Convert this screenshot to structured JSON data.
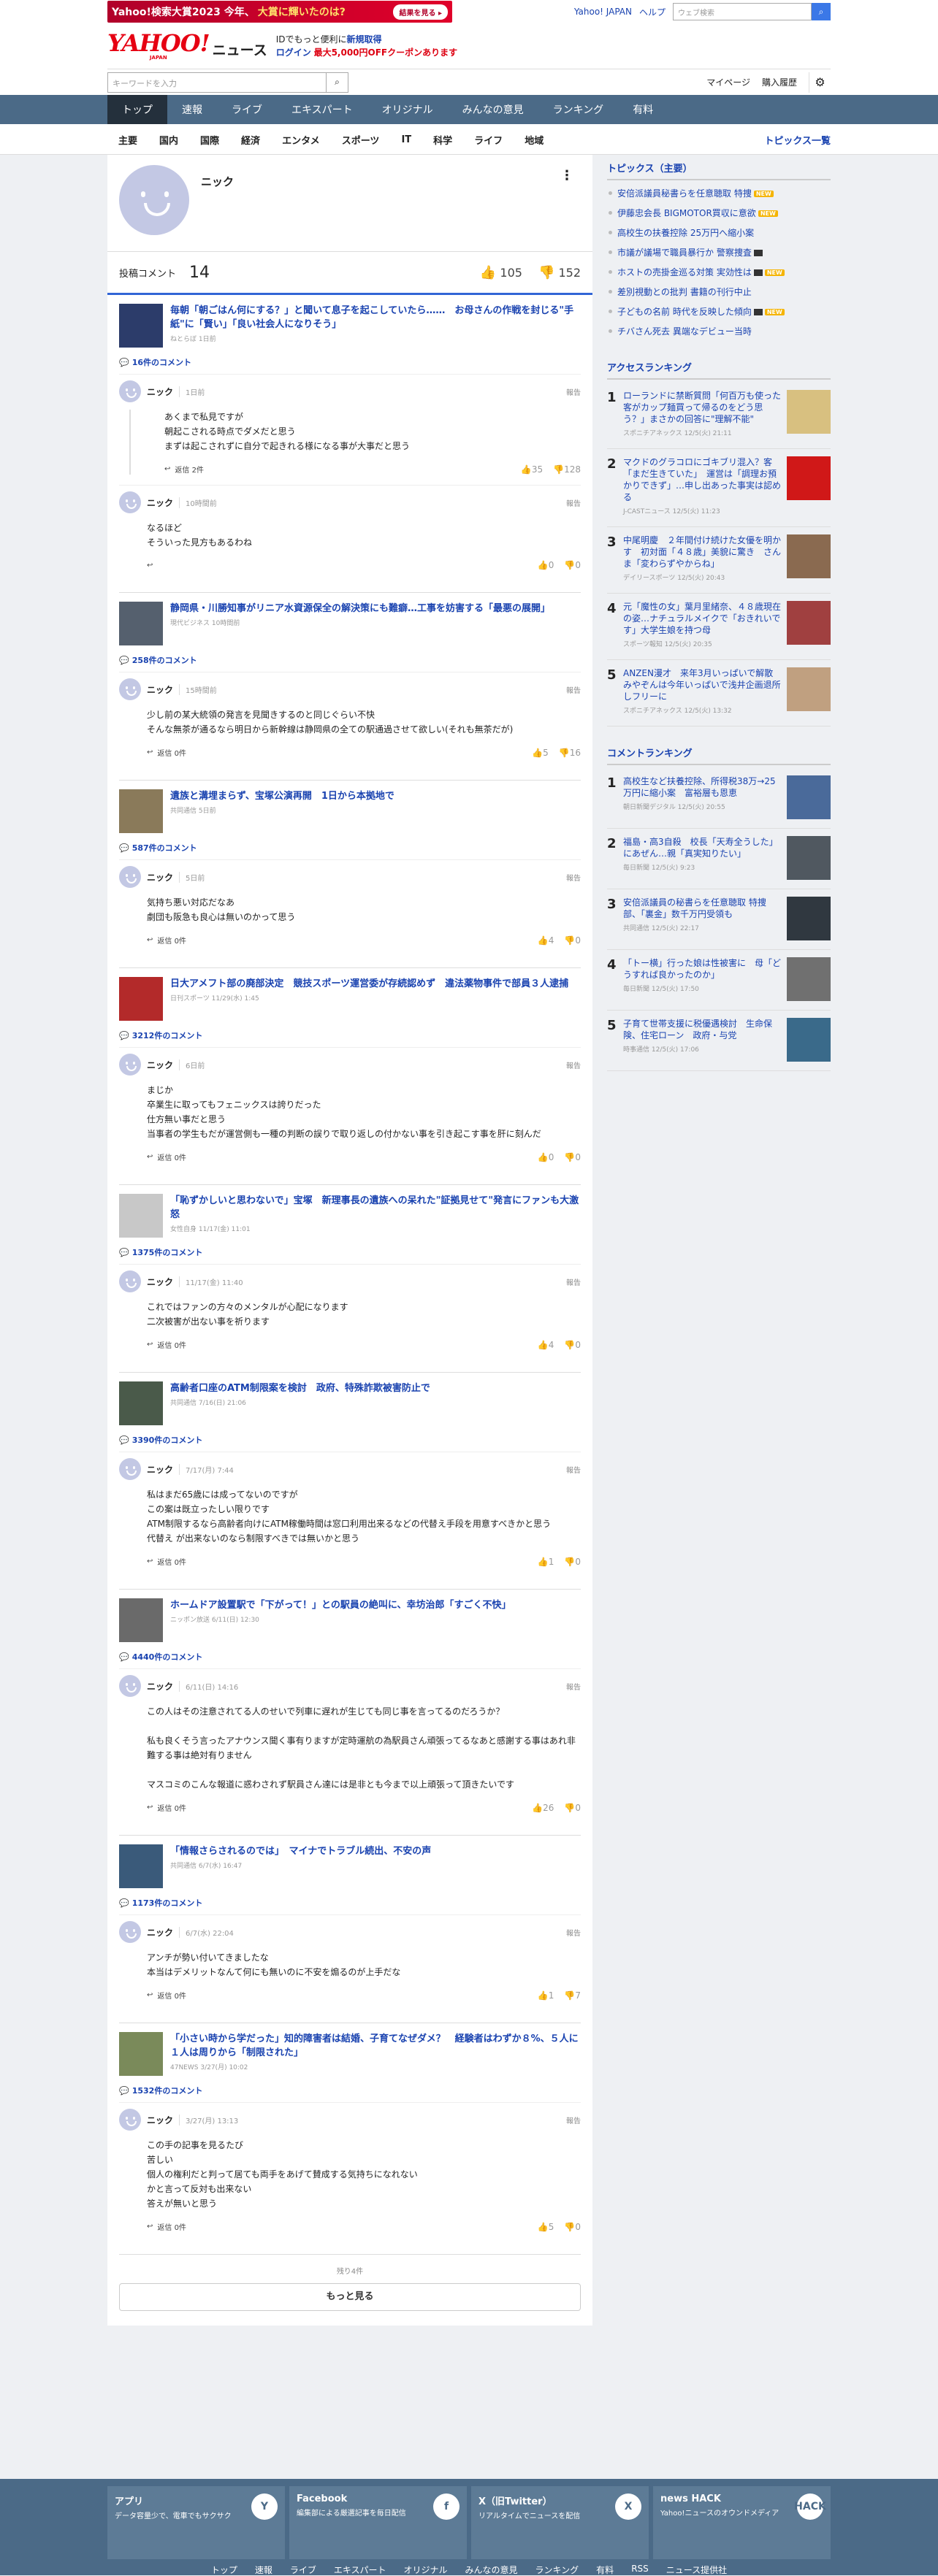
{
  "header": {
    "promo": {
      "text": "Yahoo!検索大賞2023 今年、",
      "highlight": "大賞に輝いたのは?",
      "button": "結果を見る ▸"
    },
    "top_links": [
      "Yahoo! JAPAN",
      "ヘルプ"
    ],
    "web_search_placeholder": "ウェブ検索",
    "logo_main": "YAHOO!",
    "logo_sub": "JAPAN",
    "logo_section": "ニュース",
    "login_line1": "IDでもっと便利に",
    "login_line1_b": "新規取得",
    "login_line2": "ログイン",
    "login_coupon": "最大5,000円OFFクーポンあります",
    "search_placeholder": "キーワードを入力",
    "links": [
      "マイページ",
      "購入履歴"
    ]
  },
  "main_nav": [
    "トップ",
    "速報",
    "ライブ",
    "エキスパート",
    "オリジナル",
    "みんなの意見",
    "ランキング",
    "有料"
  ],
  "sub_nav": [
    "主要",
    "国内",
    "国際",
    "経済",
    "エンタメ",
    "スポーツ",
    "IT",
    "科学",
    "ライフ",
    "地域"
  ],
  "sub_nav_more": "トピックス一覧",
  "profile": {
    "name": "ニック",
    "kebab": "⋮",
    "label": "投稿コメント",
    "count": "14",
    "likes": "105",
    "dislikes": "152"
  },
  "articles": [
    {
      "title": "毎朝「朝ごはん何にする？」と聞いて息子を起こしていたら……　お母さんの作戦を封じる\"手紙\"に「賢い」「良い社会人になりそう」",
      "src": "ねとらぼ 1日前",
      "ccount": "16件のコメント",
      "img": "#2c3c6a",
      "comments": [
        {
          "date": "1日前",
          "body": "あくまで私見ですが\n朝起こされる時点でダメだと思う\nまずは起こされずに自分で起きれる様になる事が大事だと思う",
          "reply": "返信 2件",
          "up": "35",
          "down": "128",
          "thread": true
        },
        {
          "date": "10時間前",
          "body": "なるほど\nそういった見方もあるわね",
          "reply": "",
          "up": "0",
          "down": "0",
          "thread": false
        }
      ]
    },
    {
      "title": "静岡県・川勝知事がリニア水資源保全の解決策にも難癖…工事を妨害する「最悪の展開」",
      "src": "現代ビジネス 10時間前",
      "ccount": "258件のコメント",
      "img": "#55606e",
      "comments": [
        {
          "date": "15時間前",
          "body": "少し前の某大統領の発言を見聞きするのと同じぐらい不快\nそんな無茶が通るなら明日から新幹線は静岡県の全ての駅通過させて欲しい(それも無茶だが)",
          "reply": "返信 0件",
          "up": "5",
          "down": "16",
          "thread": false
        }
      ]
    },
    {
      "title": "遺族と溝埋まらず、宝塚公演再開　1日から本拠地で",
      "src": "共同通信 5日前",
      "ccount": "587件のコメント",
      "img": "#8a7a5a",
      "comments": [
        {
          "date": "5日前",
          "body": "気持ち悪い対応だなあ\n劇団も阪急も良心は無いのかって思う",
          "reply": "返信 0件",
          "up": "4",
          "down": "0",
          "thread": false
        }
      ]
    },
    {
      "title": "日大アメフト部の廃部決定　競技スポーツ運営委が存続認めず　違法薬物事件で部員３人逮捕",
      "src": "日刊スポーツ 11/29(水) 1:45",
      "ccount": "3212件のコメント",
      "img": "#b32a2a",
      "comments": [
        {
          "date": "6日前",
          "body": "まじか\n卒業生に取ってもフェニックスは誇りだった\n仕方無い事だと思う\n当事者の学生もだが運営側も一種の判断の誤りで取り返しの付かない事を引き起こす事を肝に刻んだ",
          "reply": "返信 0件",
          "up": "0",
          "down": "0",
          "thread": false
        }
      ]
    },
    {
      "title": "「恥ずかしいと思わないで」宝塚　新理事長の遺族への呆れた\"証拠見せて\"発言にファンも大激怒",
      "src": "女性自身 11/17(金) 11:01",
      "ccount": "1375件のコメント",
      "img": "#c8c8c8",
      "comments": [
        {
          "date": "11/17(金) 11:40",
          "body": "これではファンの方々のメンタルが心配になります\n二次被害が出ない事を祈ります",
          "reply": "返信 0件",
          "up": "4",
          "down": "0",
          "thread": false
        }
      ]
    },
    {
      "title": "高齢者口座のATM制限案を検討　政府、特殊詐欺被害防止で",
      "src": "共同通信 7/16(日) 21:06",
      "ccount": "3390件のコメント",
      "img": "#4a5a4a",
      "comments": [
        {
          "date": "7/17(月) 7:44",
          "body": "私はまだ65歳には成ってないのですが\nこの案は既立ったしい限りです\nATM制限するなら高齢者向けにATM稼働時間は窓口利用出来るなどの代替え手段を用意すべきかと思う\n代替え が出来ないのなら制限すべきでは無いかと思う",
          "reply": "返信 0件",
          "up": "1",
          "down": "0",
          "thread": false
        }
      ]
    },
    {
      "title": "ホームドア設置駅で「下がって！」との駅員の絶叫に、幸坊治郎「すごく不快」",
      "src": "ニッポン放送 6/11(日) 12:30",
      "ccount": "4440件のコメント",
      "img": "#6a6a6a",
      "comments": [
        {
          "date": "6/11(日) 14:16",
          "body": "この人はその注意されてる人のせいで列車に遅れが生じても同じ事を言ってるのだろうか？\n\n私も良くそう言ったアナウンス聞く事有りますが定時運航の為駅員さん頑張ってるなあと感謝する事はあれ非難する事は絶対有りません\n\nマスコミのこんな報道に惑わされず駅員さん達には是非とも今まで以上頑張って頂きたいです",
          "reply": "返信 0件",
          "up": "26",
          "down": "0",
          "thread": false
        }
      ]
    },
    {
      "title": "「情報さらされるのでは」　マイナでトラブル続出、不安の声",
      "src": "共同通信 6/7(水) 16:47",
      "ccount": "1173件のコメント",
      "img": "#3a5a7a",
      "comments": [
        {
          "date": "6/7(水) 22:04",
          "body": "アンチが勢い付いてきましたな\n本当はデメリットなんて何にも無いのに不安を煽るのが上手だな",
          "reply": "返信 0件",
          "up": "1",
          "down": "7",
          "thread": false
        }
      ]
    },
    {
      "title": "「小さい時から学だった」知的障害者は結婚、子育てなぜダメ？　経験者はわずか８%、５人に１人は周りから「制限された」",
      "src": "47NEWS 3/27(月) 10:02",
      "ccount": "1532件のコメント",
      "img": "#7a8a5a",
      "comments": [
        {
          "date": "3/27(月) 13:13",
          "body": "この手の記事を見るたび\n苦しい\n個人の権利だと判って居ても両手をあげて賛成する気持ちになれない\nかと言って反対も出来ない\n答えが無いと思う",
          "reply": "返信 0件",
          "up": "5",
          "down": "0",
          "thread": false
        }
      ]
    }
  ],
  "remaining": "残り4件",
  "more_button": "もっと見る",
  "topics": {
    "title": "トピックス（主要）",
    "items": [
      {
        "t": "安倍派議員秘書らを任意聴取 特捜",
        "badge": "new"
      },
      {
        "t": "伊藤忠会長 BIGMOTOR買収に意欲",
        "badge": "new"
      },
      {
        "t": "高校生の扶養控除 25万円へ縮小案",
        "badge": ""
      },
      {
        "t": "市議が議場で職員暴行か 警察捜査",
        "badge": "video"
      },
      {
        "t": "ホストの売掛金巡る対策 実効性は",
        "badge": "both"
      },
      {
        "t": "差別視動との批判 書籍の刊行中止",
        "badge": ""
      },
      {
        "t": "子どもの名前 時代を反映した傾向",
        "badge": "both"
      },
      {
        "t": "チバさん死去 異端なデビュー当時",
        "badge": ""
      }
    ]
  },
  "access_ranking": {
    "title": "アクセスランキング",
    "items": [
      {
        "no": "1",
        "t": "ローランドに禁断質問「何百万も使った客がカップ麺買って帰るのをどう思う？」まさかの回答に\"理解不能\"",
        "src": "スポニチアネックス 12/5(火) 21:11",
        "img": "#d8c080"
      },
      {
        "no": "2",
        "t": "マクドのグラコロにゴキブリ混入？客「まだ生きていた」　運営は「調理お預かりできず」…申し出あった事実は認める",
        "src": "J-CASTニュース 12/5(火) 11:23",
        "img": "#d01818"
      },
      {
        "no": "3",
        "t": "中尾明慶　２年間付け続けた女優を明かす　初対面「４８歳」美貌に驚き　さんま「変わらずやからね」",
        "src": "デイリースポーツ 12/5(火) 20:43",
        "img": "#8a6a50"
      },
      {
        "no": "4",
        "t": "元「魔性の女」葉月里緒奈、４８歳現在の姿…ナチュラルメイクで「おきれいです」大学生娘を持つ母",
        "src": "スポーツ報知 12/5(火) 20:35",
        "img": "#a04040"
      },
      {
        "no": "5",
        "t": "ANZEN漫才　来年3月いっぱいで解散　みやぞんは今年いっぱいで浅井企画退所しフリーに",
        "src": "スポニチアネックス 12/5(火) 13:32",
        "img": "#c0a080"
      }
    ]
  },
  "comment_ranking": {
    "title": "コメントランキング",
    "items": [
      {
        "no": "1",
        "t": "高校生など扶養控除、所得税38万→25万円に縮小案　富裕層も恩恵",
        "src": "朝日新聞デジタル 12/5(火) 20:55",
        "img": "#4a6a9a"
      },
      {
        "no": "2",
        "t": "福島・高3自殺　校長「天寿全うした」にあぜん…親「真実知りたい」",
        "src": "毎日新聞 12/5(火) 9:23",
        "img": "#505860"
      },
      {
        "no": "3",
        "t": "安倍派議員の秘書らを任意聴取 特捜部、「裏金」数千万円受領も",
        "src": "共同通信 12/5(火) 22:17",
        "img": "#303840"
      },
      {
        "no": "4",
        "t": "「トー横」行った娘は性被害に　母「どうすれば良かったのか」",
        "src": "毎日新聞 12/5(火) 17:50",
        "img": "#707070"
      },
      {
        "no": "5",
        "t": "子育て世帯支援に税優遇検討　生命保険、住宅ローン　政府・与党",
        "src": "時事通信 12/5(火) 17:06",
        "img": "#3a6a8a"
      }
    ]
  },
  "footer": {
    "cards": [
      {
        "t": "アプリ",
        "d": "データ容量少で、電車でもサクサク",
        "ic": "Y"
      },
      {
        "t": "Facebook",
        "d": "編集部による厳選記事を毎日配信",
        "ic": "f"
      },
      {
        "t": "X（旧Twitter）",
        "d": "リアルタイムでニュースを配信",
        "ic": "X"
      },
      {
        "t": "news HACK",
        "d": "Yahoo!ニュースのオウンドメディア",
        "ic": "HACK"
      }
    ],
    "nav": [
      "トップ",
      "速報",
      "ライブ",
      "エキスパート",
      "オリジナル",
      "みんなの意見",
      "ランキング",
      "有料",
      "RSS",
      "ニュース提供社"
    ]
  }
}
